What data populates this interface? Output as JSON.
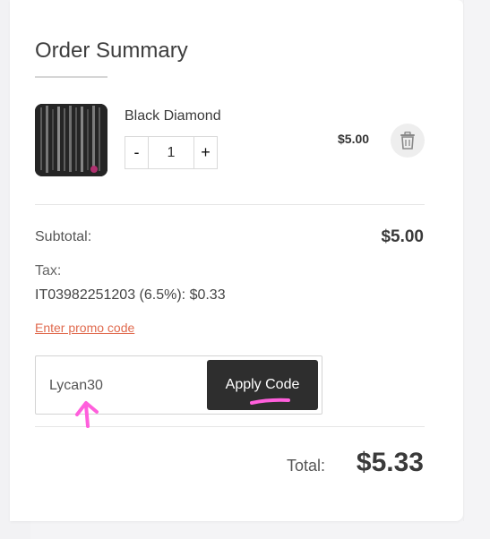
{
  "summary": {
    "title": "Order Summary"
  },
  "item": {
    "name": "Black Diamond",
    "qty_minus": "-",
    "qty_value": "1",
    "qty_plus": "+",
    "price": "$5.00",
    "thumbnail_icon": "product-thumbnail",
    "delete_icon": "trash-icon"
  },
  "totals": {
    "subtotal_label": "Subtotal:",
    "subtotal_value": "$5.00",
    "tax_label": "Tax:",
    "tax_value": "IT03982251203 (6.5%): $0.33",
    "total_label": "Total:",
    "total_value": "$5.33"
  },
  "promo": {
    "link_text": "Enter promo code",
    "input_value": "Lycan30",
    "apply_label": "Apply Code"
  },
  "colors": {
    "promo_link": "#e06a4e",
    "apply_button": "#2e2e2e",
    "annotation": "#ff5fdc"
  }
}
